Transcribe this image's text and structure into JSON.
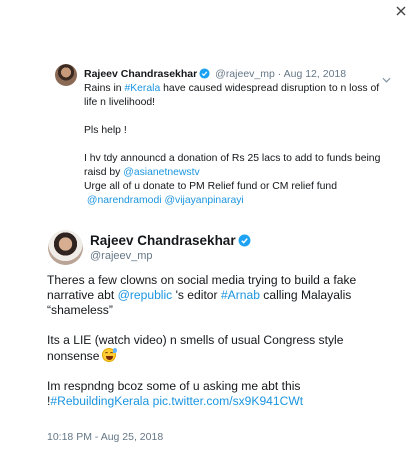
{
  "colors": {
    "link": "#1b95e0",
    "verified": "#1da1f2",
    "muted": "#657786",
    "text": "#14171a"
  },
  "icons": {
    "close": "close-icon",
    "verified": "verified-badge-icon",
    "chevron": "chevron-down-icon",
    "emoji": "grinning-sweat-emoji"
  },
  "quoted": {
    "name": "Rajeev Chandrasekhar",
    "handle": "@rajeev_mp",
    "separator": "·",
    "date": "Aug 12, 2018",
    "line1_pre": "Rains in ",
    "line1_tag": "#Kerala",
    "line1_post": " have caused widespread disruption to n loss of",
    "line2": "life n livelihood!",
    "line3": "Pls help !",
    "line4": "I hv tdy announcd a donation of Rs 25 lacs to add to funds being",
    "line5_pre": "raisd by ",
    "line5_mention": "@asianetnewstv",
    "line6": "Urge all of u donate to PM Relief fund or CM relief fund",
    "line7_mention1": "@narendramodi",
    "line7_mention2": "@vijayanpinarayi"
  },
  "main": {
    "name": "Rajeev Chandrasekhar",
    "handle": "@rajeev_mp",
    "p1_l1": "Theres a few clowns on social media trying to build a fake",
    "p1_l2_pre": "narrative abt ",
    "p1_l2_mention": "@republic",
    "p1_l2_mid": " 's editor ",
    "p1_l2_tag": "#Arnab",
    "p1_l2_post": " calling Malayalis",
    "p1_l3": "“shameless”",
    "p2_l1": "Its a LIE (watch video) n smells of usual Congress style",
    "p2_l2": "nonsense",
    "p3_l1": "Im respndng bcoz some of u asking me abt this",
    "p3_l2_pre": "!",
    "p3_l2_tag": "#RebuildingKerala",
    "p3_l2_link": "pic.twitter.com/sx9K941CWt",
    "timestamp": "10:18 PM - Aug 25, 2018"
  }
}
